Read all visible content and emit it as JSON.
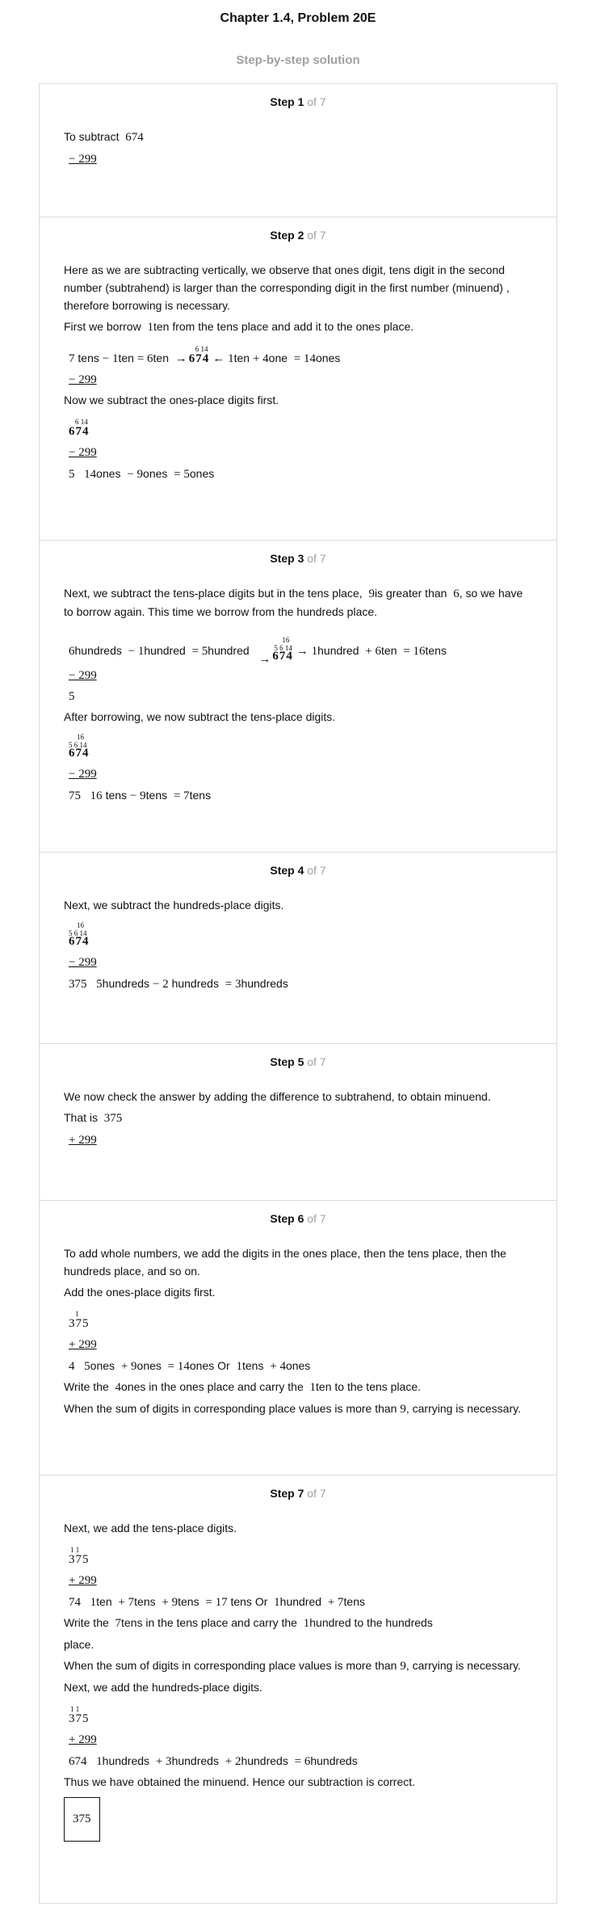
{
  "title": "Chapter 1.4, Problem 20E",
  "subtitle": "Step-by-step solution",
  "of_total": "of 7",
  "steps": [
    {
      "label": "Step 1",
      "lines": [
        "To subtract",
        "674",
        "− 299"
      ]
    },
    {
      "label": "Step 2",
      "para1": "Here as we are subtracting vertically, we observe that ones digit, tens digit in the second number (subtrahend) is larger than the corresponding digit in the first number (minuend) , therefore borrowing is necessary.",
      "para2a": "First we borrow",
      "para2b": "1",
      "para2c": "ten from the tens place and add it to the ones place.",
      "eq1": [
        "7",
        "tens",
        "− 1",
        "ten",
        "= 6",
        "ten",
        "→",
        "6 14",
        "674",
        "←",
        "1",
        "ten",
        "+ 4",
        "one",
        "= 14",
        "ones"
      ],
      "sub": "− 299",
      "para3": "Now we subtract the ones-place digits first.",
      "stack_sup": "6 14",
      "stack_num": "674",
      "eq2": [
        "5",
        "14",
        "ones",
        "− 9",
        "ones",
        "= 5",
        "ones"
      ]
    },
    {
      "label": "Step 3",
      "para1a": "Next, we subtract the tens-place digits but in the tens place,",
      "para1b": "9",
      "para1c": "is greater than",
      "para1d": "6",
      "para1e": ", so we have to borrow again. This time we borrow from the hundreds place.",
      "eq1": [
        "6",
        "hundreds",
        "− 1",
        "hundred",
        "= 5",
        "hundred",
        "→",
        "16",
        "5 6 14",
        "674",
        "→",
        "1",
        "hundred",
        "+ 6",
        "ten",
        "= 16",
        "tens"
      ],
      "sub": "− 299",
      "res": "5",
      "para2": "After borrowing, we now subtract the tens-place digits.",
      "stack_sup1": "16",
      "stack_sup2": "5 6 14",
      "stack_num": "674",
      "eq2": [
        "75",
        "16",
        "tens",
        "− 9",
        "tens",
        "= 7",
        "tens"
      ]
    },
    {
      "label": "Step 4",
      "para1": "Next, we subtract the hundreds-place digits.",
      "stack_sup1": "16",
      "stack_sup2": "5 6 14",
      "stack_num": "674",
      "sub": "− 299",
      "eq": [
        "375",
        "5",
        "hundreds",
        "− 2",
        "hundreds",
        "= 3",
        "hundreds"
      ]
    },
    {
      "label": "Step 5",
      "para1": "We now check the answer by adding the difference to subtrahend, to obtain minuend.",
      "para2a": "That is",
      "para2b": "375",
      "add": "+ 299"
    },
    {
      "label": "Step 6",
      "para1": "To add whole numbers, we add the digits in the ones place, then the tens place, then the hundreds place, and so on.",
      "para2": "Add the ones-place digits first.",
      "stack_sup": "1",
      "stack_num": "375",
      "add": "+ 299",
      "eq": [
        "4",
        "5",
        "ones",
        "+ 9",
        "ones",
        "= 14",
        "ones Or",
        "1",
        "tens",
        "+ 4",
        "ones"
      ],
      "w1": "Write the",
      "w2": "4",
      "w3": "ones in the ones place and carry the",
      "w4": "1",
      "w5": "ten to the tens place.",
      "rule1": "When the sum of digits in corresponding place values is more than",
      "rule2": "9",
      "rule3": ", carrying is necessary."
    },
    {
      "label": "Step 7",
      "para1": "Next, we add the tens-place digits.",
      "stack_sup": "1 1",
      "stack_num": "375",
      "add": "+ 299",
      "eq1": [
        "74",
        "1",
        "ten",
        "+ 7",
        "tens",
        "+ 9",
        "tens",
        "= 17",
        "tens Or",
        "1",
        "hundred",
        "+ 7",
        "tens"
      ],
      "w1": "Write the",
      "w2": "7",
      "w3": "tens in the tens place and carry the",
      "w4": "1",
      "w5": "hundred to the hundreds",
      "w6": "place.",
      "rule1": "When the sum of digits in corresponding place values is more than",
      "rule2": "9",
      "rule3": ", carrying is necessary.",
      "para2": "Next, we add the hundreds-place digits.",
      "eq2": [
        "674",
        "1",
        "hundreds",
        "+ 3",
        "hundreds",
        "+ 2",
        "hundreds",
        "= 6",
        "hundreds"
      ],
      "para3": "Thus we have obtained the minuend. Hence our subtraction is correct.",
      "answer": "375"
    }
  ]
}
